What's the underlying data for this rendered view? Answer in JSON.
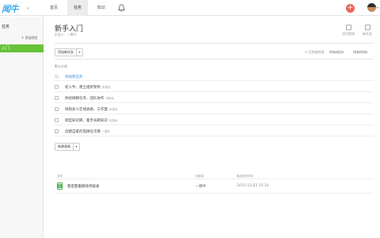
{
  "header": {
    "logo": "闻牛",
    "nav": [
      {
        "label": "首页",
        "active": false
      },
      {
        "label": "任务",
        "active": true
      },
      {
        "label": "知识",
        "active": false
      }
    ],
    "add_label": "+",
    "accent_color": "#3fa8e8",
    "add_color": "#f06257"
  },
  "sidebar": {
    "title": "任务",
    "add_project": "+ 添加项目",
    "items": [
      {
        "label": "入门",
        "active": true,
        "color": "#67c23a"
      }
    ]
  },
  "main": {
    "title": "新手入门",
    "subtitle": "负责人：一颗牛",
    "header_actions": [
      {
        "label": "项目管理",
        "icon": "person-gear-icon"
      },
      {
        "label": "新任务",
        "icon": "edit-icon"
      }
    ],
    "toolbar": {
      "add_task": "添加新任务",
      "check_label": "✔ 已完成任务",
      "filter1": "所有成员▾",
      "filter2": "所有时间▾"
    },
    "section": "默认分组",
    "add_task_link": "添加新任务",
    "tasks": [
      {
        "title": "初入牛，建立组织架构",
        "status": "未指派"
      },
      {
        "title": "体验微聊任务、团队协作",
        "status": "未指派"
      },
      {
        "title": "快照多人在线表格、工作量",
        "status": "未指派"
      },
      {
        "title": "刚型知识库、着手贡献知识",
        "status": "未指派"
      },
      {
        "title": "创建自家的电微任识库",
        "status": "一颗牛"
      }
    ],
    "files": {
      "add_file": "新建表格",
      "columns": [
        "名称",
        "创建者",
        "最后修改时间"
      ],
      "rows": [
        {
          "name": "售后客服绩效考核表",
          "owner": "一颗牛",
          "time": "2015-12-03 15:10"
        }
      ]
    }
  }
}
